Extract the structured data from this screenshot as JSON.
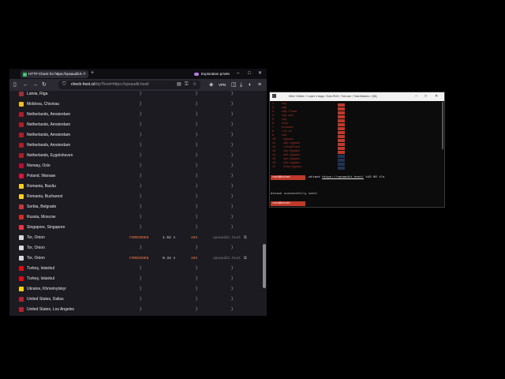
{
  "browser": {
    "tab_title": "HTTP Check for https://vpsaudit.host",
    "tab_icon": "check-icon",
    "private_label": "Exploration privée",
    "address": {
      "host": "check-host.cc",
      "path": "/http?host=https://vpsaudit.host/"
    },
    "vpn_label": "VPN"
  },
  "rows": [
    {
      "location": "Latvia, Riga",
      "flag": "#9e3039"
    },
    {
      "location": "Moldova, Chisinau",
      "flag": "#f0c020"
    },
    {
      "location": "Netherlands, Amsterdam",
      "flag": "#ae1c28"
    },
    {
      "location": "Netherlands, Amsterdam",
      "flag": "#ae1c28"
    },
    {
      "location": "Netherlands, Amsterdam",
      "flag": "#ae1c28"
    },
    {
      "location": "Netherlands, Amsterdam",
      "flag": "#ae1c28"
    },
    {
      "location": "Netherlands, Eygelshoven",
      "flag": "#ae1c28"
    },
    {
      "location": "Norway, Oslo",
      "flag": "#ba0c2f"
    },
    {
      "location": "Poland, Warsaw",
      "flag": "#dc143c"
    },
    {
      "location": "Romania, Bacău",
      "flag": "#fcd116"
    },
    {
      "location": "Romania, Bucharest",
      "flag": "#fcd116"
    },
    {
      "location": "Serbia, Belgrade",
      "flag": "#c6363c"
    },
    {
      "location": "Russia, Moscow",
      "flag": "#d52b1e"
    },
    {
      "location": "Singapore, Singapore",
      "flag": "#ef3340"
    },
    {
      "location": "Tor, Onion",
      "flag": "#d8d8d8",
      "status": "FORBIDDEN",
      "time": "1.52 s",
      "code": "403",
      "ip": "vpsaudit.host"
    },
    {
      "location": "Tor, Onion",
      "flag": "#d8d8d8"
    },
    {
      "location": "Tor, Onion",
      "flag": "#d8d8d8",
      "status": "FORBIDDEN",
      "time": "0.34 s",
      "code": "403",
      "ip": "vpsaudit.host"
    },
    {
      "location": "Turkey, Istanbul",
      "flag": "#e30a17"
    },
    {
      "location": "Turkey, Istanbul",
      "flag": "#e30a17"
    },
    {
      "location": "Ukraine, Khmelnytskyi",
      "flag": "#ffd500"
    },
    {
      "location": "United States, Dallas",
      "flag": "#b22234"
    },
    {
      "location": "United States, Los Angeles",
      "flag": "#b22234"
    }
  ],
  "pending_glyph": "⟩",
  "terminal": {
    "title": "Mini / Online / / Layer 4 dago / Golo RUS / Tolo ssn / Total Attacks > [34]",
    "method_lines": [
      {
        "num": "1",
        "name": "tcp"
      },
      {
        "num": "2",
        "name": "udp"
      },
      {
        "num": "3",
        "name": "udp-flood"
      },
      {
        "num": "4",
        "name": "syn-ack"
      },
      {
        "num": "5",
        "name": "tcp"
      },
      {
        "num": "6",
        "name": "http"
      },
      {
        "num": "7",
        "name": "browser"
      },
      {
        "num": "8",
        "name": "tls-v1"
      },
      {
        "num": "9",
        "name": "ovh"
      },
      {
        "num": "10",
        "name": "bypass"
      },
      {
        "num": "11",
        "name": "udp-bypass"
      },
      {
        "num": "12",
        "name": "cloudflare"
      },
      {
        "num": "13",
        "name": "tcp-bypass"
      },
      {
        "num": "14",
        "name": "ack-bypass"
      },
      {
        "num": "15",
        "name": "syn-bypass"
      },
      {
        "num": "16",
        "name": "ssh-bypass"
      },
      {
        "num": "17",
        "name": "http-bypass"
      }
    ],
    "prompt_label": "root@botnet",
    "command_prefix": ".attack ",
    "command_url": "https://vpsaudit.host/",
    "command_suffix": " 443 60 tls",
    "success_message": "Attack successfully sent!"
  }
}
